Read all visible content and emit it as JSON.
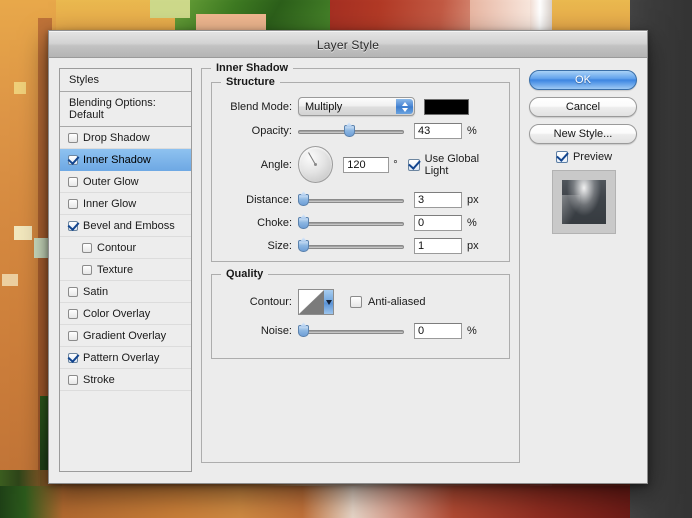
{
  "window": {
    "title": "Layer Style"
  },
  "styles_panel": {
    "header": "Styles",
    "blending_options": "Blending Options: Default",
    "items": [
      {
        "label": "Drop Shadow",
        "checked": false,
        "indent": false,
        "selected": false
      },
      {
        "label": "Inner Shadow",
        "checked": true,
        "indent": false,
        "selected": true
      },
      {
        "label": "Outer Glow",
        "checked": false,
        "indent": false,
        "selected": false
      },
      {
        "label": "Inner Glow",
        "checked": false,
        "indent": false,
        "selected": false
      },
      {
        "label": "Bevel and Emboss",
        "checked": true,
        "indent": false,
        "selected": false
      },
      {
        "label": "Contour",
        "checked": false,
        "indent": true,
        "selected": false
      },
      {
        "label": "Texture",
        "checked": false,
        "indent": true,
        "selected": false
      },
      {
        "label": "Satin",
        "checked": false,
        "indent": false,
        "selected": false
      },
      {
        "label": "Color Overlay",
        "checked": false,
        "indent": false,
        "selected": false
      },
      {
        "label": "Gradient Overlay",
        "checked": false,
        "indent": false,
        "selected": false
      },
      {
        "label": "Pattern Overlay",
        "checked": true,
        "indent": false,
        "selected": false
      },
      {
        "label": "Stroke",
        "checked": false,
        "indent": false,
        "selected": false
      }
    ]
  },
  "inner_shadow": {
    "group_title": "Inner Shadow",
    "structure": {
      "title": "Structure",
      "blend_mode_label": "Blend Mode:",
      "blend_mode_value": "Multiply",
      "shadow_color": "#000000",
      "opacity_label": "Opacity:",
      "opacity_value": "43",
      "opacity_unit": "%",
      "angle_label": "Angle:",
      "angle_value": "120",
      "angle_unit": "°",
      "use_global_light_label": "Use Global Light",
      "use_global_light_checked": true,
      "distance_label": "Distance:",
      "distance_value": "3",
      "distance_unit": "px",
      "choke_label": "Choke:",
      "choke_value": "0",
      "choke_unit": "%",
      "size_label": "Size:",
      "size_value": "1",
      "size_unit": "px"
    },
    "quality": {
      "title": "Quality",
      "contour_label": "Contour:",
      "anti_aliased_label": "Anti-aliased",
      "anti_aliased_checked": false,
      "noise_label": "Noise:",
      "noise_value": "0",
      "noise_unit": "%"
    }
  },
  "buttons": {
    "ok": "OK",
    "cancel": "Cancel",
    "new_style": "New Style...",
    "preview_label": "Preview",
    "preview_checked": true
  },
  "colors": {
    "accent_blue": "#3d85e0",
    "selection_blue": "#6fa9e4",
    "dialog_bg": "#ececec",
    "desktop_dark": "#3b3b3b"
  }
}
